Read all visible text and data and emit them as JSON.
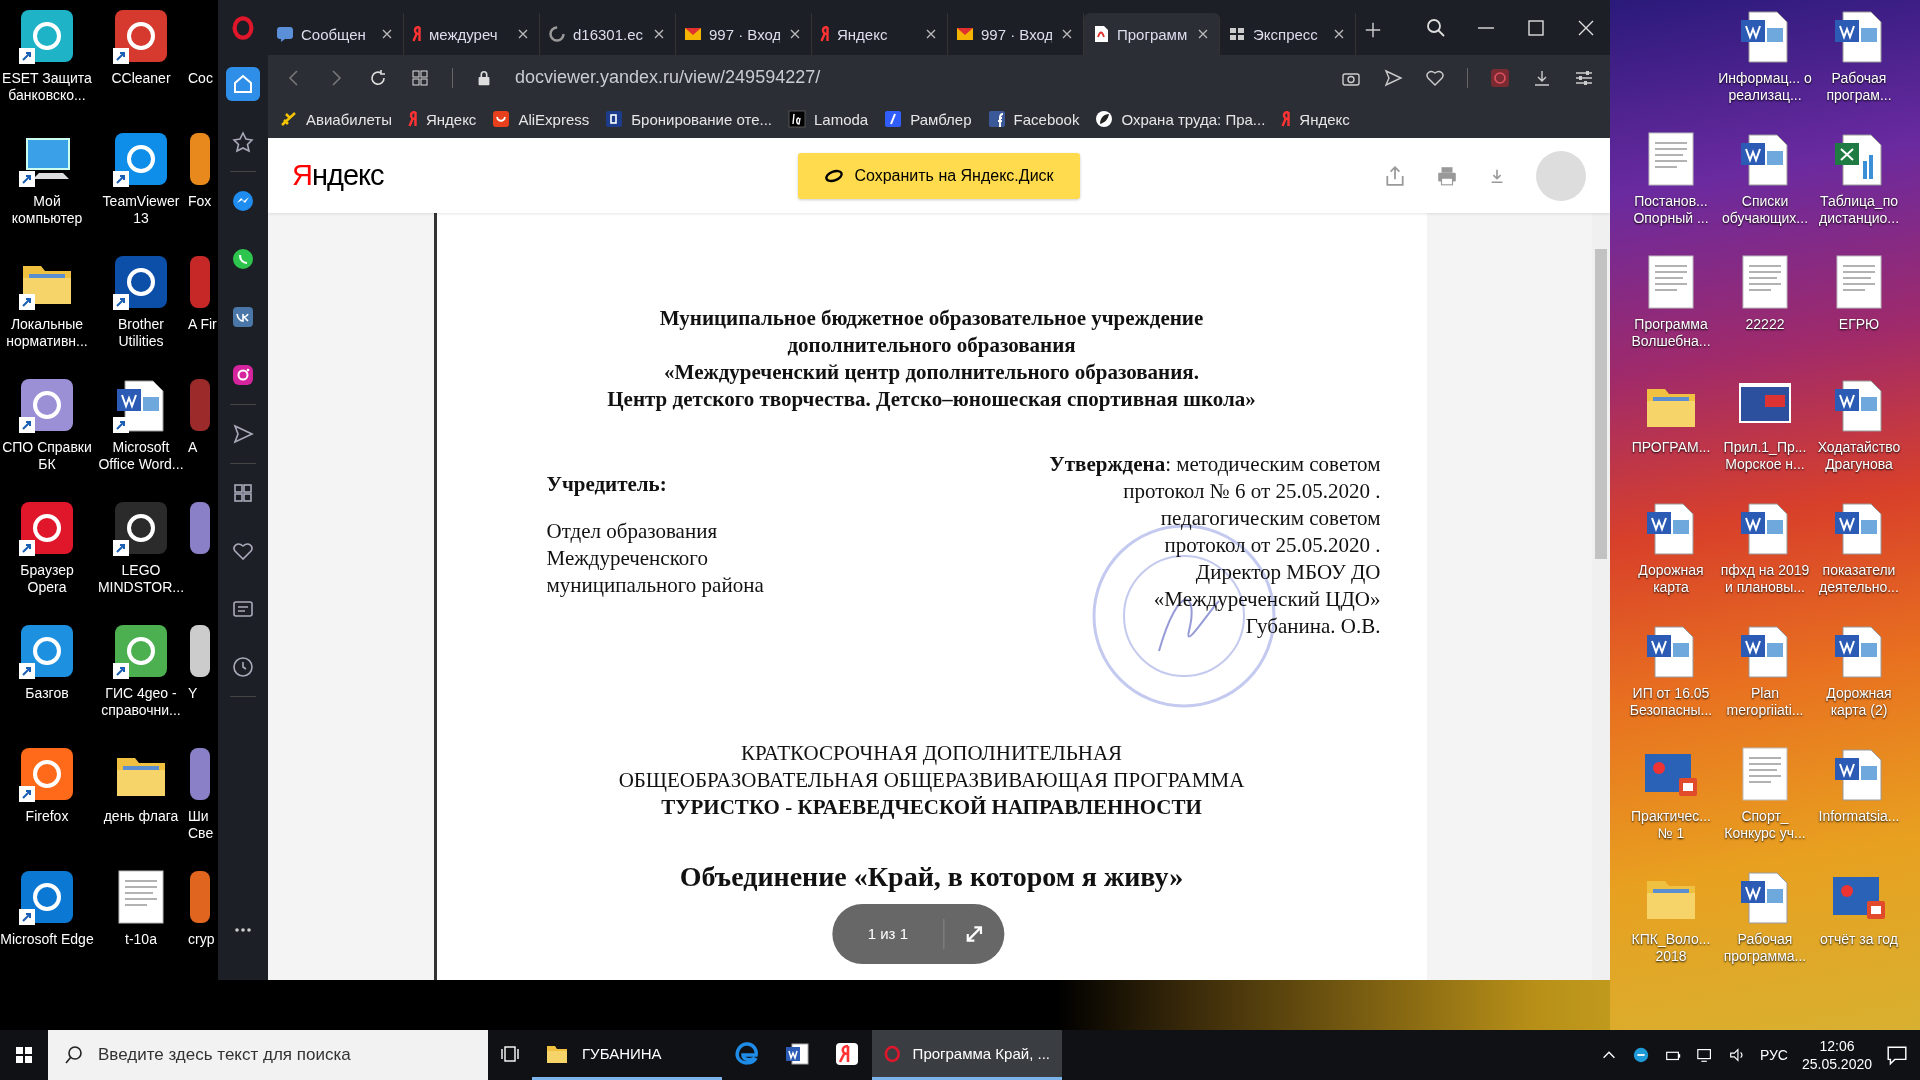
{
  "desktop": {
    "left_rows": [
      {
        "icons": [
          {
            "label": "ESET Защита банковско...",
            "kind": "app",
            "color": "#1fb3c8",
            "shortcut": true
          },
          {
            "label": "CCleaner",
            "kind": "app",
            "color": "#d63a2f",
            "shortcut": true
          },
          {
            "label": "Coc",
            "kind": "blank"
          }
        ]
      },
      {
        "icons": [
          {
            "label": "Мой компьютер",
            "kind": "computer",
            "shortcut": true
          },
          {
            "label": "TeamViewer 13",
            "kind": "app",
            "color": "#0e8ee9",
            "shortcut": true
          },
          {
            "label": "Fox",
            "kind": "app",
            "color": "#e8891e"
          }
        ]
      },
      {
        "icons": [
          {
            "label": "Локальные нормативн...",
            "kind": "folder",
            "shortcut": true
          },
          {
            "label": "Brother Utilities",
            "kind": "app",
            "color": "#0b4fa8",
            "shortcut": true
          },
          {
            "label": "A Fir",
            "kind": "app",
            "color": "#c62828"
          }
        ]
      },
      {
        "icons": [
          {
            "label": "СПО Справки БК",
            "kind": "app",
            "color": "#9b8fd6",
            "shortcut": true
          },
          {
            "label": "Microsoft Office Word...",
            "kind": "word",
            "shortcut": true
          },
          {
            "label": "A",
            "kind": "app",
            "color": "#9c2a2a"
          }
        ]
      },
      {
        "icons": [
          {
            "label": "Браузер Opera",
            "kind": "app",
            "color": "#e0162b",
            "shortcut": true
          },
          {
            "label": "LEGO MINDSTOR...",
            "kind": "app",
            "color": "#2b2b2b",
            "shortcut": true
          },
          {
            "kind": "app",
            "color": "#8a80c8"
          }
        ]
      },
      {
        "icons": [
          {
            "label": "Базгов",
            "kind": "app",
            "color": "#1e90e0",
            "shortcut": true
          },
          {
            "label": "ГИС 4geo - справочни...",
            "kind": "app",
            "color": "#4caf50",
            "shortcut": true
          },
          {
            "label": "Y",
            "kind": "app",
            "color": "#cccccc"
          }
        ]
      },
      {
        "icons": [
          {
            "label": "Firefox",
            "kind": "app",
            "color": "#ff6a1a",
            "shortcut": true
          },
          {
            "label": "день флага",
            "kind": "folder",
            "shortcut": false
          },
          {
            "label": "Ши Све",
            "kind": "app",
            "color": "#8a80c8"
          }
        ]
      },
      {
        "icons": [
          {
            "label": "Microsoft Edge",
            "kind": "app",
            "color": "#0b78d4",
            "shortcut": true
          },
          {
            "label": "t-10a",
            "kind": "doc",
            "shortcut": false
          },
          {
            "label": "cryp",
            "kind": "app",
            "color": "#e0651e"
          }
        ]
      }
    ],
    "right_rows": [
      {
        "icons": [
          {
            "label": "Информац... о реализац...",
            "kind": "word"
          },
          {
            "label": "Рабочая програм...",
            "kind": "word"
          }
        ]
      },
      {
        "icons": [
          {
            "label": "Постанов... Опорный ...",
            "kind": "doc"
          },
          {
            "label": "Списки обучающих...",
            "kind": "word"
          },
          {
            "label": "Таблица_по дистанцио...",
            "kind": "excel"
          }
        ]
      },
      {
        "icons": [
          {
            "label": "Программа Волшебна...",
            "kind": "doc"
          },
          {
            "label": "22222",
            "kind": "doc"
          },
          {
            "label": "ЕГРЮ",
            "kind": "doc"
          }
        ]
      },
      {
        "icons": [
          {
            "label": "ПРОГРАМ...",
            "kind": "folder"
          },
          {
            "label": "Прил.1_Пр... Морское н...",
            "kind": "image"
          },
          {
            "label": "Ходатайство Драгунова",
            "kind": "word"
          }
        ]
      },
      {
        "icons": [
          {
            "label": "Дорожная карта",
            "kind": "word"
          },
          {
            "label": "пфхд на 2019 и плановы...",
            "kind": "word"
          },
          {
            "label": "показатели деятельно...",
            "kind": "word"
          }
        ]
      },
      {
        "icons": [
          {
            "label": "ИП от 16.05 Безопасны...",
            "kind": "word"
          },
          {
            "label": "Plan meropriiati...",
            "kind": "word"
          },
          {
            "label": "Дорожная карта (2)",
            "kind": "word"
          }
        ]
      },
      {
        "icons": [
          {
            "label": "Практичес... № 1",
            "kind": "slides"
          },
          {
            "label": "Спорт_ Конкурс уч...",
            "kind": "doc"
          },
          {
            "label": "Informatsia...",
            "kind": "word"
          }
        ]
      },
      {
        "icons": [
          {
            "label": "КПК_Воло... 2018",
            "kind": "folder"
          },
          {
            "label": "Рабочая программа...",
            "kind": "word"
          },
          {
            "label": "отчёт за год",
            "kind": "slides"
          }
        ]
      }
    ]
  },
  "browser": {
    "tabs": [
      {
        "title": "Сообщен",
        "kind": "chat",
        "selected": false
      },
      {
        "title": "междуреч",
        "kind": "yandex",
        "selected": false
      },
      {
        "title": "d16301.ec",
        "kind": "loading",
        "selected": false
      },
      {
        "title": "997 · Вход",
        "kind": "mail",
        "selected": false
      },
      {
        "title": "Яндекс",
        "kind": "yandex",
        "selected": false
      },
      {
        "title": "997 · Вход",
        "kind": "mail",
        "selected": false
      },
      {
        "title": "Программ",
        "kind": "pdf",
        "selected": true
      },
      {
        "title": "Экспресс",
        "kind": "grid",
        "selected": false
      }
    ],
    "url": "docviewer.yandex.ru/view/249594227/",
    "bookmarks": [
      {
        "label": "Авиабилеты",
        "kind": "plane"
      },
      {
        "label": "Яндекс",
        "kind": "yandex"
      },
      {
        "label": "AliExpress",
        "kind": "aliexpress"
      },
      {
        "label": "Бронирование оте...",
        "kind": "booking"
      },
      {
        "label": "Lamoda",
        "kind": "lamoda"
      },
      {
        "label": "Рамблер",
        "kind": "rambler"
      },
      {
        "label": "Facebook",
        "kind": "facebook"
      },
      {
        "label": "Охрана труда: Пра...",
        "kind": "leaf"
      },
      {
        "label": "Яндекс",
        "kind": "yandex"
      }
    ],
    "sidebar": [
      {
        "items": [
          {
            "kind": "home",
            "selected": true
          },
          {
            "kind": "star",
            "selected": false
          }
        ]
      },
      {
        "items": [
          {
            "kind": "messenger",
            "selected": false
          },
          {
            "kind": "whatsapp",
            "selected": false
          },
          {
            "kind": "vk",
            "selected": false
          },
          {
            "kind": "instagram",
            "selected": false
          }
        ]
      },
      {
        "items": [
          {
            "kind": "send",
            "selected": false
          }
        ]
      },
      {
        "items": [
          {
            "kind": "grid",
            "selected": false
          },
          {
            "kind": "heart",
            "selected": false
          },
          {
            "kind": "news",
            "selected": false
          },
          {
            "kind": "history",
            "selected": false
          }
        ]
      }
    ]
  },
  "viewer": {
    "logo": "Яндекс",
    "save_button": "Сохранить на Яндекс.Диск",
    "pager": "1 из 1",
    "document": {
      "header_lines": [
        "Муниципальное бюджетное образовательное учреждение",
        "дополнительного образования",
        "«Междуреченский центр дополнительного образования.",
        "Центр детского творчества. Детско–юношеская спортивная школа»"
      ],
      "founder_label": "Учредитель:",
      "founder_lines": [
        "Отдел образования",
        "Междуреченского",
        "муниципального района"
      ],
      "approval_lines": [
        "**Утверждена**: методическим советом",
        "протокол № 6 от 25.05.2020 .",
        "педагогическим советом",
        "протокол от 25.05.2020 .",
        "Директор МБОУ ДО",
        "«Междуреченский ЦДО»",
        "Губанина. О.В."
      ],
      "title_lines": [
        {
          "text": "КРАТКОСРОЧНАЯ ДОПОЛНИТЕЛЬНАЯ",
          "bold": false
        },
        {
          "text": "ОБЩЕОБРАЗОВАТЕЛЬНАЯ ОБЩЕРАЗВИВАЮЩАЯ ПРОГРАММА",
          "bold": false
        },
        {
          "text": "ТУРИСТКО - КРАЕВЕДЧЕСКОЙ НАПРАВЛЕННОСТИ",
          "bold": true
        }
      ],
      "association": "Объединение «Край, в котором я живу»"
    }
  },
  "taskbar": {
    "search_placeholder": "Введите здесь текст для поиска",
    "apps": [
      {
        "kind": "folder",
        "label": "ГУБАНИНА",
        "selected": false,
        "running": true
      },
      {
        "kind": "edge",
        "selected": false,
        "running": false
      },
      {
        "kind": "word",
        "selected": false,
        "running": false
      },
      {
        "kind": "yandex",
        "selected": false,
        "running": false
      },
      {
        "kind": "opera",
        "label": "Программа Край, ...",
        "selected": true,
        "running": true
      }
    ],
    "language": "РУС",
    "time": "12:06",
    "date": "25.05.2020"
  }
}
